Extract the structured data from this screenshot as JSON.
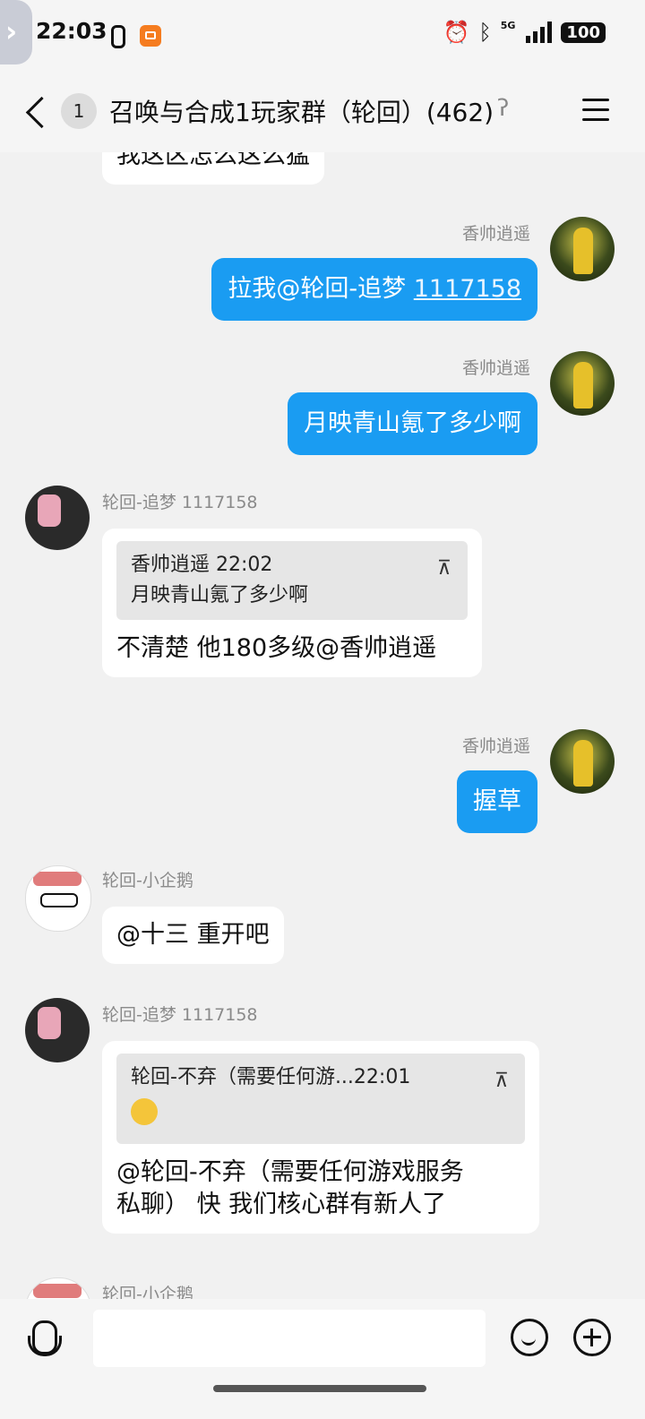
{
  "status_bar": {
    "time": "22:03",
    "battery": "100",
    "network": "5G",
    "icons": [
      "link-icon",
      "app-icon",
      "alarm-icon",
      "bluetooth-icon",
      "signal-icon",
      "battery-icon"
    ]
  },
  "header": {
    "back_icon": "chevron-left-icon",
    "unread_count": "1",
    "title": "召唤与合成1玩家群（轮回）(462)",
    "ear_icon": "ear-icon",
    "menu_icon": "hamburger-menu-icon"
  },
  "messages": [
    {
      "text": "我这区怎么这么猛"
    },
    {
      "sender": "香帅逍遥",
      "text": "拉我@轮回-追梦 ",
      "link": "1117158"
    },
    {
      "sender": "香帅逍遥",
      "text": "月映青山氪了多少啊"
    },
    {
      "sender": "轮回-追梦 1117158",
      "quote": {
        "header": "香帅逍遥 22:02",
        "body": "月映青山氪了多少啊"
      },
      "text": "不清楚 他180多级@香帅逍遥"
    },
    {
      "sender": "香帅逍遥",
      "text": "握草"
    },
    {
      "sender": "轮回-小企鹅",
      "text": "@十三 重开吧"
    },
    {
      "sender": "轮回-追梦 1117158",
      "quote": {
        "header": "轮回-不弃（需要任何游...22:01"
      },
      "text_line1": "@轮回-不弃（需要任何游戏服务",
      "text_line2": "私聊） 快 我们核心群有新人了"
    },
    {
      "sender": "轮回-小企鹅"
    }
  ],
  "input": {
    "placeholder": ""
  }
}
